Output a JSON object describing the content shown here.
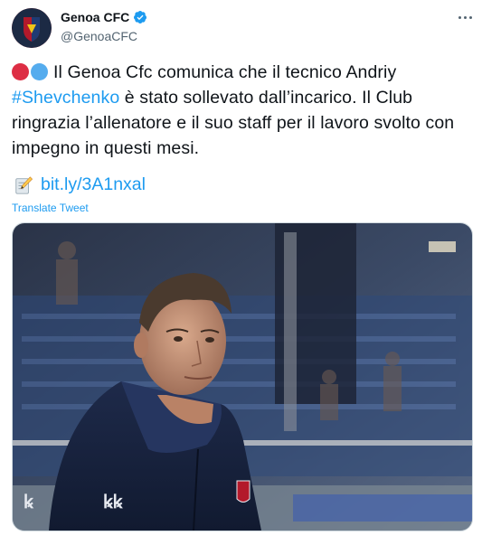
{
  "header": {
    "display_name": "Genoa CFC",
    "handle": "@GenoaCFC",
    "verified": true,
    "avatar_icon": "genoa-crest-icon"
  },
  "tweet": {
    "text_before_hashtag": "Il Genoa Cfc comunica che il tecnico Andriy ",
    "hashtag": "#Shevchenko",
    "text_after_hashtag": " è stato sollevato dall’incarico. Il Club ringrazia l’allenatore e il suo staff per il lavoro svolto con impegno in questi mesi.",
    "emoji_dots": [
      "red-circle",
      "blue-circle"
    ],
    "link_icon": "memo-icon",
    "link": "bit.ly/3A1nxal",
    "translate_label": "Translate Tweet"
  },
  "media": {
    "icon": "photo-of-coach",
    "brand_logos": [
      "Kappa"
    ]
  },
  "colors": {
    "link": "#1d9bf0",
    "text": "#0f1419",
    "secondary": "#536471",
    "red_dot": "#dd2e44",
    "blue_dot": "#55acee"
  }
}
